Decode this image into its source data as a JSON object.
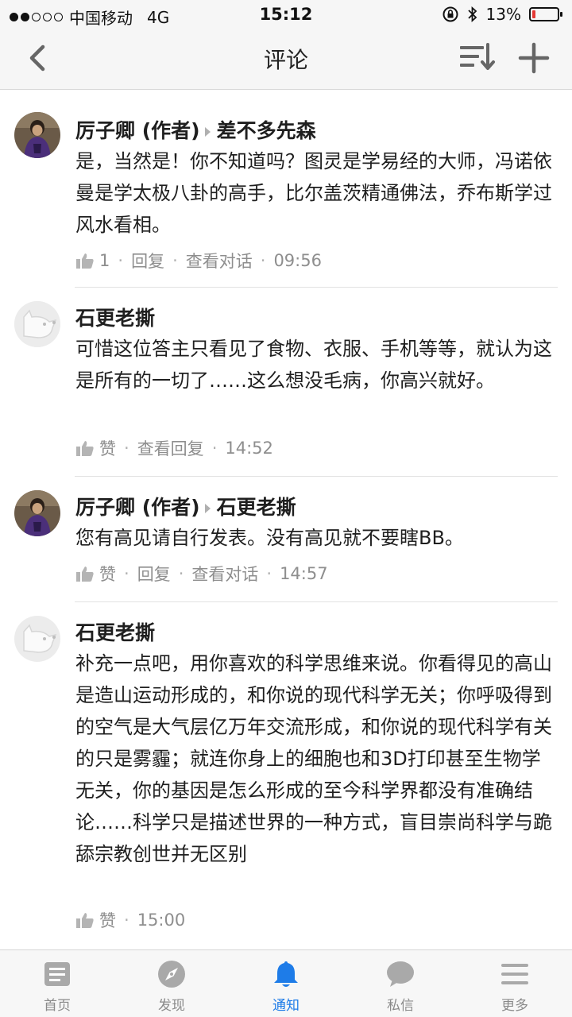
{
  "status_bar": {
    "carrier": "中国移动",
    "network": "4G",
    "time": "15:12",
    "battery_percent": "13%",
    "battery_level": 0.13,
    "signal_bars": 2
  },
  "nav": {
    "title": "评论",
    "icons": {
      "back": "chevron-left-icon",
      "sort": "sort-icon",
      "add": "plus-icon"
    }
  },
  "comments": [
    {
      "author": "厉子卿 (作者)",
      "reply_to": "差不多先森",
      "avatar": "photo",
      "text": "是，当然是！你不知道吗？图灵是学易经的大师，冯诺依曼是学太极八卦的高手，比尔盖茨精通佛法，乔布斯学过风水看相。",
      "likes": "1",
      "actions": [
        "回复",
        "查看对话"
      ],
      "time": "09:56"
    },
    {
      "author": "石更老撕",
      "avatar": "default",
      "text": "可惜这位答主只看见了食物、衣服、手机等等，就认为这是所有的一切了……这么想没毛病，你高兴就好。",
      "likes": "赞",
      "actions": [
        "查看回复"
      ],
      "time": "14:52"
    },
    {
      "author": "厉子卿 (作者)",
      "reply_to": "石更老撕",
      "avatar": "photo",
      "text": "您有高见请自行发表。没有高见就不要瞎BB。",
      "likes": "赞",
      "actions": [
        "回复",
        "查看对话"
      ],
      "time": "14:57"
    },
    {
      "author": "石更老撕",
      "avatar": "default",
      "text": "补充一点吧，用你喜欢的科学思维来说。你看得见的高山是造山运动形成的，和你说的现代科学无关；你呼吸得到的空气是大气层亿万年交流形成，和你说的现代科学有关的只是雾霾；就连你身上的细胞也和3D打印甚至生物学无关，你的基因是怎么形成的至今科学界都没有准确结论……科学只是描述世界的一种方式，盲目崇尚科学与跪舔宗教创世并无区别",
      "likes": "赞",
      "actions": [],
      "time": "15:00"
    }
  ],
  "tabbar": {
    "active_color": "#1e7ce8",
    "inactive_color": "#8a8a8a",
    "tabs": [
      {
        "label": "首页",
        "icon": "home-icon"
      },
      {
        "label": "发现",
        "icon": "compass-icon"
      },
      {
        "label": "通知",
        "icon": "bell-icon",
        "active": true
      },
      {
        "label": "私信",
        "icon": "chat-bubble-icon"
      },
      {
        "label": "更多",
        "icon": "menu-icon"
      }
    ]
  }
}
